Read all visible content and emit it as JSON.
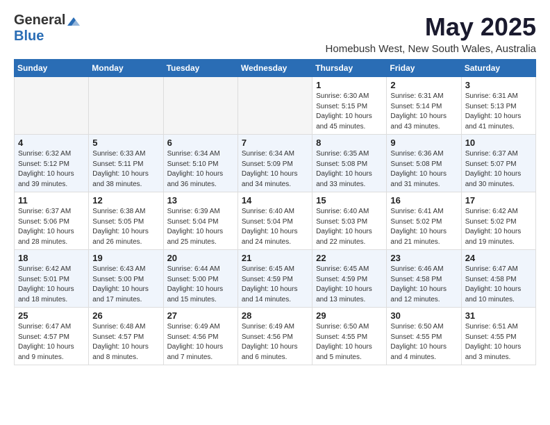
{
  "header": {
    "logo_general": "General",
    "logo_blue": "Blue",
    "month_title": "May 2025",
    "subtitle": "Homebush West, New South Wales, Australia"
  },
  "days_of_week": [
    "Sunday",
    "Monday",
    "Tuesday",
    "Wednesday",
    "Thursday",
    "Friday",
    "Saturday"
  ],
  "weeks": [
    {
      "days": [
        {
          "num": "",
          "info": ""
        },
        {
          "num": "",
          "info": ""
        },
        {
          "num": "",
          "info": ""
        },
        {
          "num": "",
          "info": ""
        },
        {
          "num": "1",
          "info": "Sunrise: 6:30 AM\nSunset: 5:15 PM\nDaylight: 10 hours\nand 45 minutes."
        },
        {
          "num": "2",
          "info": "Sunrise: 6:31 AM\nSunset: 5:14 PM\nDaylight: 10 hours\nand 43 minutes."
        },
        {
          "num": "3",
          "info": "Sunrise: 6:31 AM\nSunset: 5:13 PM\nDaylight: 10 hours\nand 41 minutes."
        }
      ]
    },
    {
      "days": [
        {
          "num": "4",
          "info": "Sunrise: 6:32 AM\nSunset: 5:12 PM\nDaylight: 10 hours\nand 39 minutes."
        },
        {
          "num": "5",
          "info": "Sunrise: 6:33 AM\nSunset: 5:11 PM\nDaylight: 10 hours\nand 38 minutes."
        },
        {
          "num": "6",
          "info": "Sunrise: 6:34 AM\nSunset: 5:10 PM\nDaylight: 10 hours\nand 36 minutes."
        },
        {
          "num": "7",
          "info": "Sunrise: 6:34 AM\nSunset: 5:09 PM\nDaylight: 10 hours\nand 34 minutes."
        },
        {
          "num": "8",
          "info": "Sunrise: 6:35 AM\nSunset: 5:08 PM\nDaylight: 10 hours\nand 33 minutes."
        },
        {
          "num": "9",
          "info": "Sunrise: 6:36 AM\nSunset: 5:08 PM\nDaylight: 10 hours\nand 31 minutes."
        },
        {
          "num": "10",
          "info": "Sunrise: 6:37 AM\nSunset: 5:07 PM\nDaylight: 10 hours\nand 30 minutes."
        }
      ]
    },
    {
      "days": [
        {
          "num": "11",
          "info": "Sunrise: 6:37 AM\nSunset: 5:06 PM\nDaylight: 10 hours\nand 28 minutes."
        },
        {
          "num": "12",
          "info": "Sunrise: 6:38 AM\nSunset: 5:05 PM\nDaylight: 10 hours\nand 26 minutes."
        },
        {
          "num": "13",
          "info": "Sunrise: 6:39 AM\nSunset: 5:04 PM\nDaylight: 10 hours\nand 25 minutes."
        },
        {
          "num": "14",
          "info": "Sunrise: 6:40 AM\nSunset: 5:04 PM\nDaylight: 10 hours\nand 24 minutes."
        },
        {
          "num": "15",
          "info": "Sunrise: 6:40 AM\nSunset: 5:03 PM\nDaylight: 10 hours\nand 22 minutes."
        },
        {
          "num": "16",
          "info": "Sunrise: 6:41 AM\nSunset: 5:02 PM\nDaylight: 10 hours\nand 21 minutes."
        },
        {
          "num": "17",
          "info": "Sunrise: 6:42 AM\nSunset: 5:02 PM\nDaylight: 10 hours\nand 19 minutes."
        }
      ]
    },
    {
      "days": [
        {
          "num": "18",
          "info": "Sunrise: 6:42 AM\nSunset: 5:01 PM\nDaylight: 10 hours\nand 18 minutes."
        },
        {
          "num": "19",
          "info": "Sunrise: 6:43 AM\nSunset: 5:00 PM\nDaylight: 10 hours\nand 17 minutes."
        },
        {
          "num": "20",
          "info": "Sunrise: 6:44 AM\nSunset: 5:00 PM\nDaylight: 10 hours\nand 15 minutes."
        },
        {
          "num": "21",
          "info": "Sunrise: 6:45 AM\nSunset: 4:59 PM\nDaylight: 10 hours\nand 14 minutes."
        },
        {
          "num": "22",
          "info": "Sunrise: 6:45 AM\nSunset: 4:59 PM\nDaylight: 10 hours\nand 13 minutes."
        },
        {
          "num": "23",
          "info": "Sunrise: 6:46 AM\nSunset: 4:58 PM\nDaylight: 10 hours\nand 12 minutes."
        },
        {
          "num": "24",
          "info": "Sunrise: 6:47 AM\nSunset: 4:58 PM\nDaylight: 10 hours\nand 10 minutes."
        }
      ]
    },
    {
      "days": [
        {
          "num": "25",
          "info": "Sunrise: 6:47 AM\nSunset: 4:57 PM\nDaylight: 10 hours\nand 9 minutes."
        },
        {
          "num": "26",
          "info": "Sunrise: 6:48 AM\nSunset: 4:57 PM\nDaylight: 10 hours\nand 8 minutes."
        },
        {
          "num": "27",
          "info": "Sunrise: 6:49 AM\nSunset: 4:56 PM\nDaylight: 10 hours\nand 7 minutes."
        },
        {
          "num": "28",
          "info": "Sunrise: 6:49 AM\nSunset: 4:56 PM\nDaylight: 10 hours\nand 6 minutes."
        },
        {
          "num": "29",
          "info": "Sunrise: 6:50 AM\nSunset: 4:55 PM\nDaylight: 10 hours\nand 5 minutes."
        },
        {
          "num": "30",
          "info": "Sunrise: 6:50 AM\nSunset: 4:55 PM\nDaylight: 10 hours\nand 4 minutes."
        },
        {
          "num": "31",
          "info": "Sunrise: 6:51 AM\nSunset: 4:55 PM\nDaylight: 10 hours\nand 3 minutes."
        }
      ]
    }
  ]
}
